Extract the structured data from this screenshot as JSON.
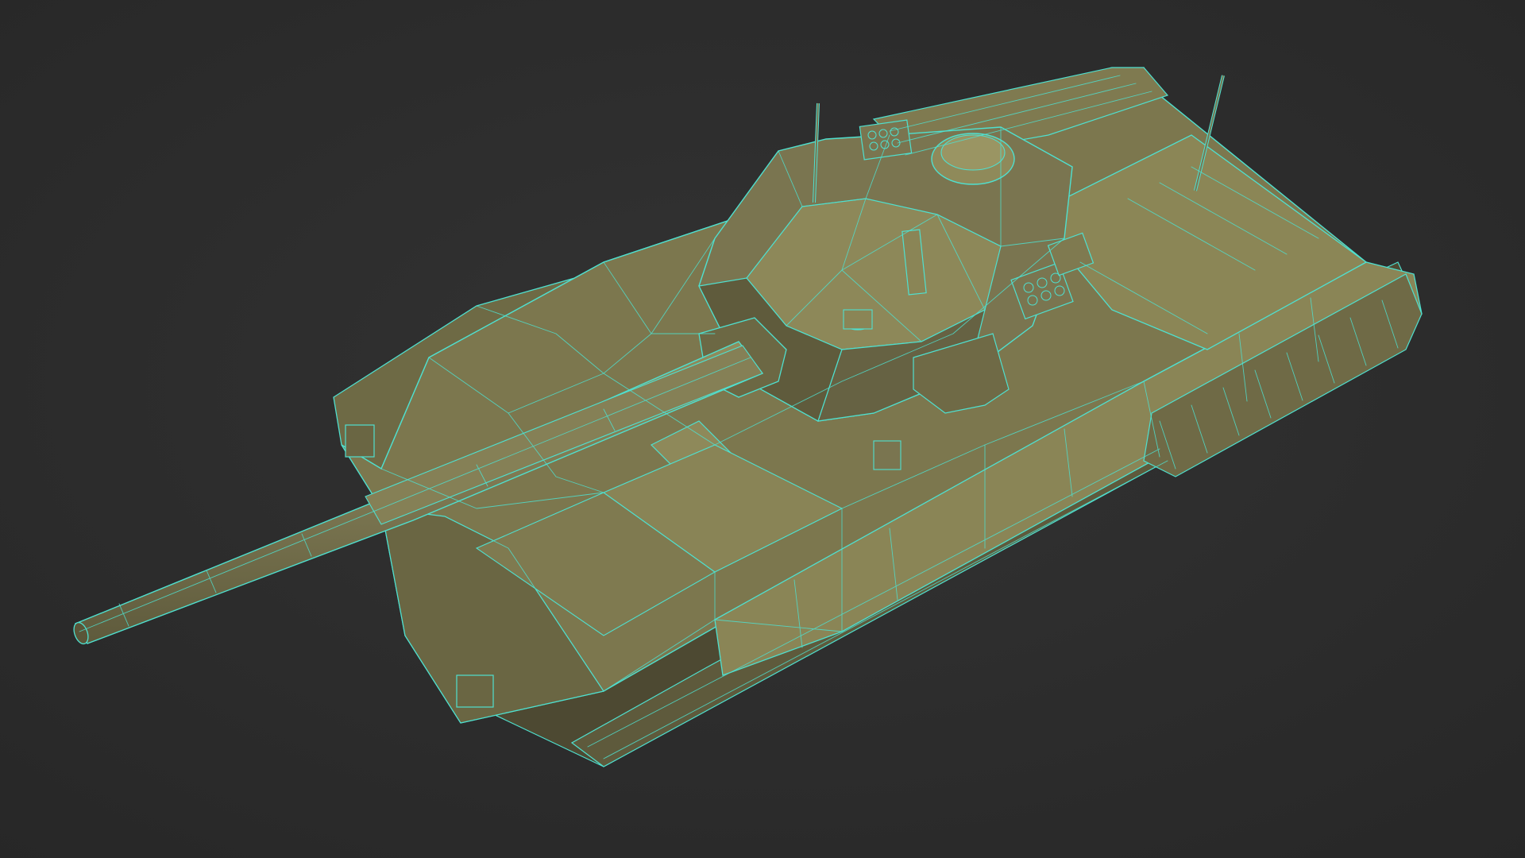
{
  "scene": {
    "subject": "3d-model-wireframe-render",
    "colors": {
      "background": "#2f2f2f",
      "background_vignette": "#262626",
      "body_base": "#75704a",
      "body_light": "#8c8758",
      "body_dark": "#5a5538",
      "body_shadow": "#4a4630",
      "wire": "#4fe0cf",
      "wire_dim": "#3cb9ad"
    }
  }
}
